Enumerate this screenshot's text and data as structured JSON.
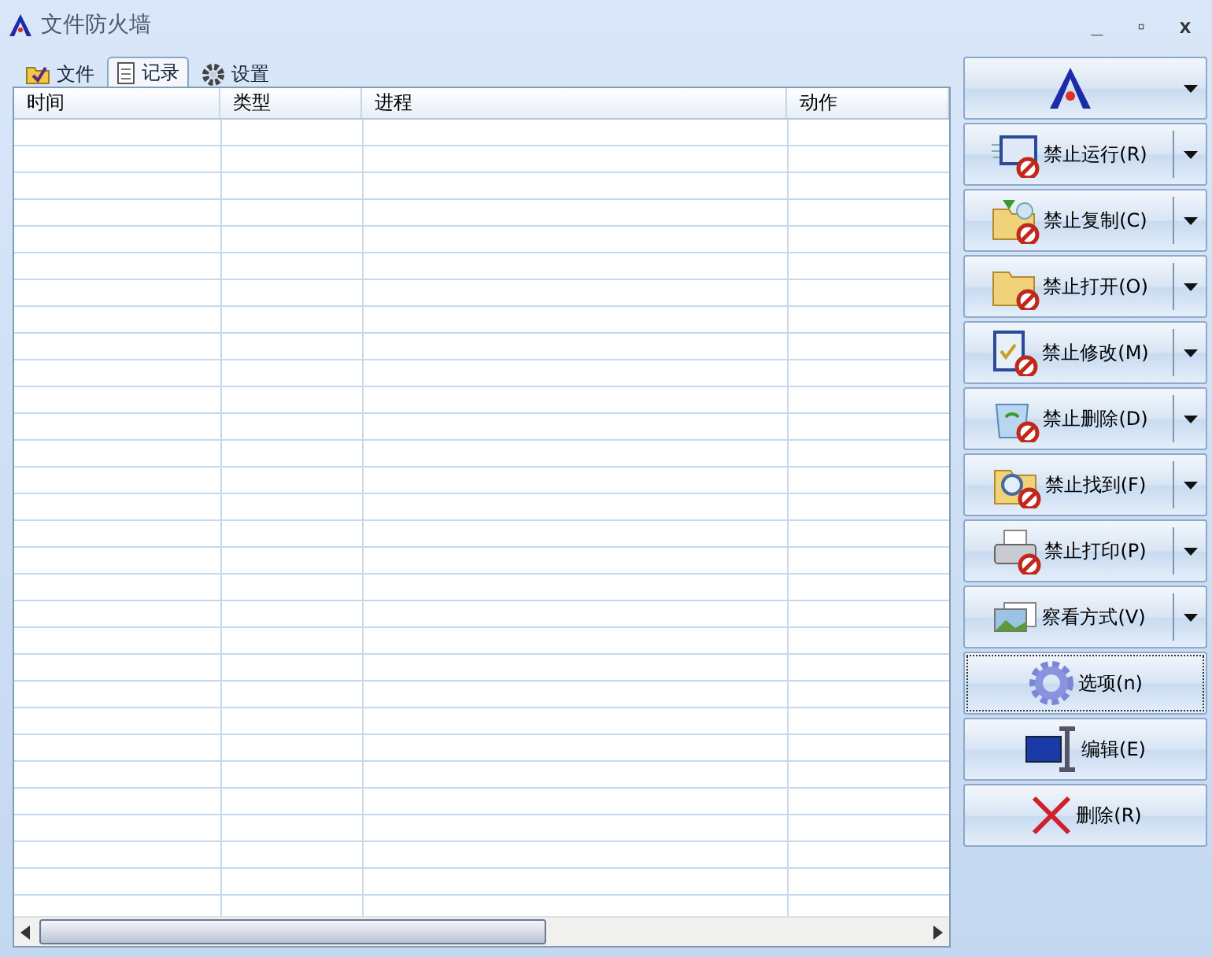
{
  "window": {
    "title": "文件防火墙",
    "controls": [
      "_",
      "▫",
      "x"
    ]
  },
  "tabs": [
    {
      "label": "文件",
      "selected": false
    },
    {
      "label": "记录",
      "selected": true
    },
    {
      "label": "设置",
      "selected": false
    }
  ],
  "table": {
    "columns": [
      "时间",
      "类型",
      "进程",
      "动作"
    ]
  },
  "side_buttons": [
    {
      "kind": "logo",
      "focused": false
    },
    {
      "kind": "split",
      "label": "禁止运行(R)",
      "focused": false
    },
    {
      "kind": "split",
      "label": "禁止复制(C)",
      "focused": false
    },
    {
      "kind": "split",
      "label": "禁止打开(O)",
      "focused": false
    },
    {
      "kind": "split",
      "label": "禁止修改(M)",
      "focused": false
    },
    {
      "kind": "split",
      "label": "禁止删除(D)",
      "focused": false
    },
    {
      "kind": "split",
      "label": "禁止找到(F)",
      "focused": false
    },
    {
      "kind": "split",
      "label": "禁止打印(P)",
      "focused": false
    },
    {
      "kind": "split",
      "label": "察看方式(V)",
      "focused": false
    },
    {
      "kind": "plain",
      "label": "选项(n)",
      "focused": true
    },
    {
      "kind": "plain",
      "label": "编辑(E)",
      "focused": false
    },
    {
      "kind": "plain",
      "label": "删除(R)",
      "focused": false
    }
  ]
}
